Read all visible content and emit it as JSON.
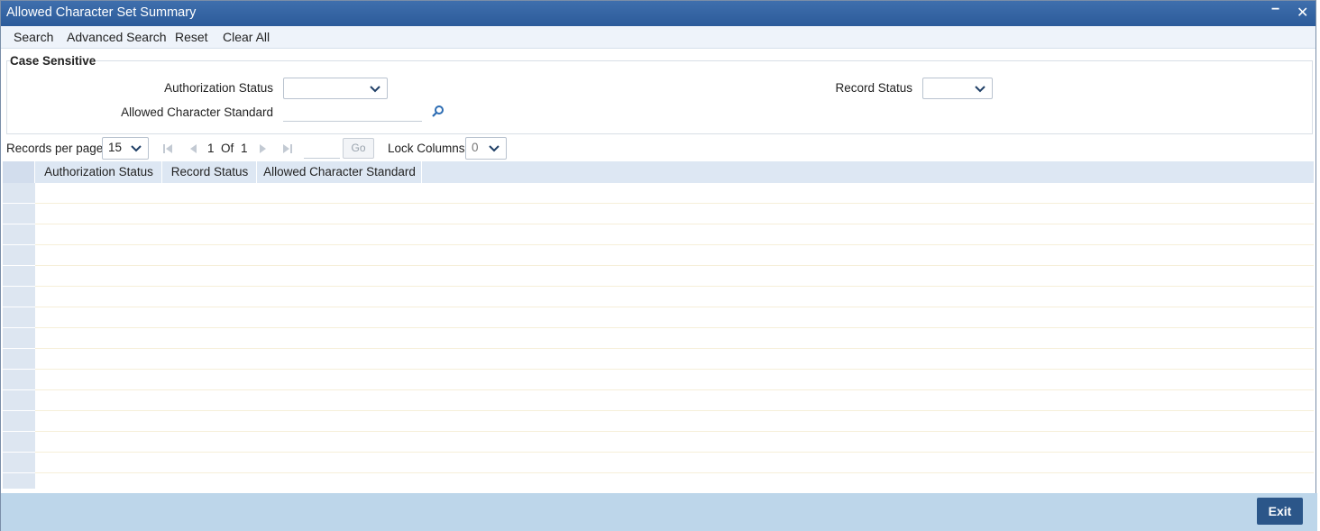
{
  "window": {
    "title": "Allowed Character Set Summary",
    "minimize_symbol": "−",
    "close_symbol": "✕"
  },
  "menu": {
    "search": "Search",
    "advanced_search": "Advanced Search",
    "reset": "Reset",
    "clear_all": "Clear All"
  },
  "criteria": {
    "legend": "Case Sensitive",
    "authorization_status_label": "Authorization Status",
    "authorization_status_value": "",
    "allowed_character_standard_label": "Allowed Character Standard",
    "allowed_character_standard_value": "",
    "record_status_label": "Record Status",
    "record_status_value": ""
  },
  "pager": {
    "records_per_page_label": "Records per page",
    "records_per_page_value": "15",
    "current_page": "1",
    "of_label": "Of",
    "total_pages": "1",
    "go_label": "Go",
    "lock_columns_label": "Lock Columns",
    "lock_columns_value": "0"
  },
  "grid": {
    "columns": [
      "Authorization Status",
      "Record Status",
      "Allowed Character Standard"
    ],
    "rows": []
  },
  "footer": {
    "exit_label": "Exit"
  },
  "colors": {
    "titlebar": "#2c5b9a",
    "footer": "#bdd6ea",
    "exit_button": "#2b5689",
    "grid_header": "#dde7f3"
  }
}
